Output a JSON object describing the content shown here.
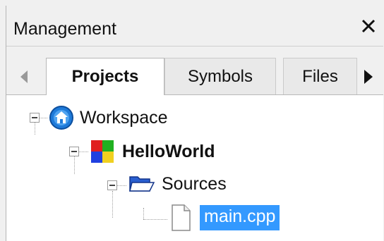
{
  "panel": {
    "title": "Management"
  },
  "tabs": [
    {
      "label": "Projects",
      "active": true
    },
    {
      "label": "Symbols",
      "active": false
    },
    {
      "label": "Files",
      "active": false
    }
  ],
  "tree": {
    "workspace": "Workspace",
    "project": "HelloWorld",
    "folder": "Sources",
    "file": "main.cpp"
  },
  "colors": {
    "selection": "#3399ff",
    "background": "#f0f0f0"
  }
}
